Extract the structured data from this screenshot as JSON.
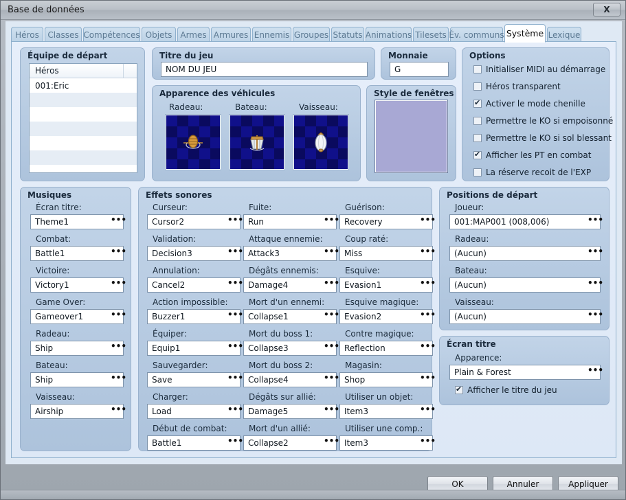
{
  "window": {
    "title": "Base de données",
    "close_label": "X"
  },
  "tabs": [
    {
      "label": "Héros",
      "active": false
    },
    {
      "label": "Classes",
      "active": false
    },
    {
      "label": "Compétences",
      "active": false
    },
    {
      "label": "Objets",
      "active": false
    },
    {
      "label": "Armes",
      "active": false
    },
    {
      "label": "Armures",
      "active": false
    },
    {
      "label": "Ennemis",
      "active": false
    },
    {
      "label": "Groupes",
      "active": false
    },
    {
      "label": "Statuts",
      "active": false
    },
    {
      "label": "Animations",
      "active": false
    },
    {
      "label": "Tilesets",
      "active": false
    },
    {
      "label": "Év. communs",
      "active": false
    },
    {
      "label": "Système",
      "active": true
    },
    {
      "label": "Lexique",
      "active": false
    }
  ],
  "starting_party": {
    "title": "Équipe de départ",
    "column_header": "Héros",
    "rows": [
      "001:Eric",
      "",
      "",
      "",
      "",
      "",
      "",
      "",
      ""
    ]
  },
  "game_title": {
    "title": "Titre du jeu",
    "value": "NOM DU JEU"
  },
  "currency": {
    "title": "Monnaie",
    "value": "G"
  },
  "vehicles": {
    "title": "Apparence des véhicules",
    "items": [
      {
        "label": "Radeau:",
        "icon": "raft-sprite"
      },
      {
        "label": "Bateau:",
        "icon": "ship-sprite"
      },
      {
        "label": "Vaisseau:",
        "icon": "airship-sprite"
      }
    ]
  },
  "window_style": {
    "title": "Style de fenêtres",
    "color": "#a8a8d4"
  },
  "options": {
    "title": "Options",
    "items": [
      {
        "label": "Initialiser MIDI au démarrage",
        "checked": false
      },
      {
        "label": "Héros transparent",
        "checked": false
      },
      {
        "label": "Activer le mode chenille",
        "checked": true
      },
      {
        "label": "Permettre le KO si empoisonné",
        "checked": false
      },
      {
        "label": "Permettre le KO si sol blessant",
        "checked": false
      },
      {
        "label": "Afficher les PT en combat",
        "checked": true
      },
      {
        "label": "La réserve recoit de l'EXP",
        "checked": false
      }
    ]
  },
  "music": {
    "title": "Musiques",
    "items": [
      {
        "label": "Écran titre:",
        "value": "Theme1"
      },
      {
        "label": "Combat:",
        "value": "Battle1"
      },
      {
        "label": "Victoire:",
        "value": "Victory1"
      },
      {
        "label": "Game Over:",
        "value": "Gameover1"
      },
      {
        "label": "Radeau:",
        "value": "Ship"
      },
      {
        "label": "Bateau:",
        "value": "Ship"
      },
      {
        "label": "Vaisseau:",
        "value": "Airship"
      }
    ]
  },
  "sound_effects": {
    "title": "Effets sonores",
    "column1": [
      {
        "label": "Curseur:",
        "value": "Cursor2"
      },
      {
        "label": "Validation:",
        "value": "Decision3"
      },
      {
        "label": "Annulation:",
        "value": "Cancel2"
      },
      {
        "label": "Action impossible:",
        "value": "Buzzer1"
      },
      {
        "label": "Équiper:",
        "value": "Equip1"
      },
      {
        "label": "Sauvegarder:",
        "value": "Save"
      },
      {
        "label": "Charger:",
        "value": "Load"
      },
      {
        "label": "Début de combat:",
        "value": "Battle1"
      }
    ],
    "column2": [
      {
        "label": "Fuite:",
        "value": "Run"
      },
      {
        "label": "Attaque ennemie:",
        "value": "Attack3"
      },
      {
        "label": "Dégâts ennemis:",
        "value": "Damage4"
      },
      {
        "label": "Mort d'un ennemi:",
        "value": "Collapse1"
      },
      {
        "label": "Mort du boss 1:",
        "value": "Collapse3"
      },
      {
        "label": "Mort du boss 2:",
        "value": "Collapse4"
      },
      {
        "label": "Dégâts sur allié:",
        "value": "Damage5"
      },
      {
        "label": "Mort d'un allié:",
        "value": "Collapse2"
      }
    ],
    "column3": [
      {
        "label": "Guérison:",
        "value": "Recovery"
      },
      {
        "label": "Coup raté:",
        "value": "Miss"
      },
      {
        "label": "Esquive:",
        "value": "Evasion1"
      },
      {
        "label": "Esquive magique:",
        "value": "Evasion2"
      },
      {
        "label": "Contre magique:",
        "value": "Reflection"
      },
      {
        "label": "Magasin:",
        "value": "Shop"
      },
      {
        "label": "Utiliser un objet:",
        "value": "Item3"
      },
      {
        "label": "Utiliser une comp.:",
        "value": "Item3"
      }
    ]
  },
  "start_positions": {
    "title": "Positions de départ",
    "items": [
      {
        "label": "Joueur:",
        "value": "001:MAP001 (008,006)"
      },
      {
        "label": "Radeau:",
        "value": "(Aucun)"
      },
      {
        "label": "Bateau:",
        "value": "(Aucun)"
      },
      {
        "label": "Vaisseau:",
        "value": "(Aucun)"
      }
    ]
  },
  "title_screen": {
    "title": "Écran titre",
    "appearance_label": "Apparence:",
    "appearance_value": "Plain & Forest",
    "checkbox": {
      "label": "Afficher le titre du jeu",
      "checked": true
    }
  },
  "footer": {
    "ok": "OK",
    "cancel": "Annuler",
    "apply": "Appliquer"
  },
  "dots_glyph": "•••"
}
